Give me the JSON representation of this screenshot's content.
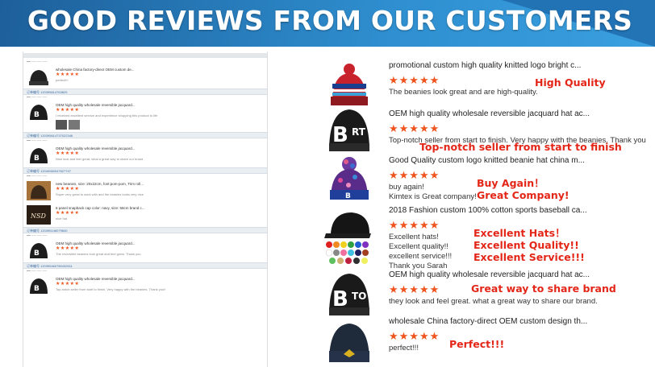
{
  "banner": {
    "title": "GOOD REVIEWS FROM OUR CUSTOMERS"
  },
  "left_panel": {
    "top_item": {
      "title": "wholesale China factory-direct OEM custom de...",
      "stars": "★★★★★",
      "text": "perfect!!!"
    },
    "blocks": [
      {
        "header": "订单编号 120395614763825",
        "title": "OEM high quality wholesale reversible jacquard...",
        "stars": "★★★★★",
        "text": "I received excellent service and experience shopping this product to life"
      },
      {
        "header": "订单编号 120395614737022346",
        "title": "OEM high quality wholesale reversible jacquard...",
        "stars": "★★★★★",
        "text": "Nice look and feel great, what a great way to share our brand"
      },
      {
        "header": "订单编号 12040060047627747",
        "title": "new beanies, size: 20x22cm, font:pom-pom, Trim roll...",
        "stars": "★★★★★",
        "text": "Super very great to work with and the beanies looks very nice"
      },
      {
        "header": "",
        "title": "6 panel snapback cap color: navy, size: 58cm brand c...",
        "stars": "★★★★★",
        "text": "nice hat"
      },
      {
        "header": "订单编号 120395146079840",
        "title": "OEM high quality wholesale reversible jacquard...",
        "stars": "★★★★★",
        "text": "The reversible beanies look great and feel great. Thank you"
      },
      {
        "header": "订单编号 120395460780432611",
        "title": "OEM high quality wholesale reversible jacquard...",
        "stars": "★★★★★",
        "text": "Top-notch seller from start to finish. Very happy with the beanies. Thank you!!"
      }
    ]
  },
  "reviews": [
    {
      "title": "promotional custom high quality knitted logo bright c...",
      "stars": "★★★★★",
      "lines": [
        "The beanies look great and are high-quality."
      ],
      "callout": [
        "High Quality"
      ]
    },
    {
      "title": "OEM high quality wholesale reversible jacquard hat ac...",
      "stars": "★★★★★",
      "lines": [
        "Top-notch seller from start to finish. Very happy with the beanies. Thank you"
      ],
      "callout": [
        "Top-notch seller from start to finish"
      ]
    },
    {
      "title": "Good Quality custom logo knitted beanie hat china m...",
      "stars": "★★★★★",
      "lines": [
        "buy again!",
        "Kimtex is Great company!"
      ],
      "callout": [
        "Buy Again！",
        "Great Company!"
      ]
    },
    {
      "title": "2018 Fashion custom 100% cotton sports baseball ca...",
      "stars": "★★★★★",
      "lines": [
        "Excellent hats!",
        "Excellent quality!!",
        "excellent service!!!",
        "Thank you Sarah"
      ],
      "callout": [
        "Excellent Hats！",
        "Excellent Quality!!",
        "Excellent Service!!!"
      ]
    },
    {
      "title": "OEM high quality wholesale reversible jacquard hat ac...",
      "stars": "★★★★★",
      "lines": [
        "they look and feel great. what a great way to share our brand."
      ],
      "callout": [
        "Great way to share brand"
      ]
    },
    {
      "title": "wholesale China factory-direct OEM custom design th...",
      "stars": "★★★★★",
      "lines": [
        "perfect!!!"
      ],
      "callout": [
        "Perfect!!!"
      ]
    }
  ],
  "colors": {
    "banner": "#2a7cc0",
    "stars": "#f0541e",
    "callout": "#e32618"
  }
}
